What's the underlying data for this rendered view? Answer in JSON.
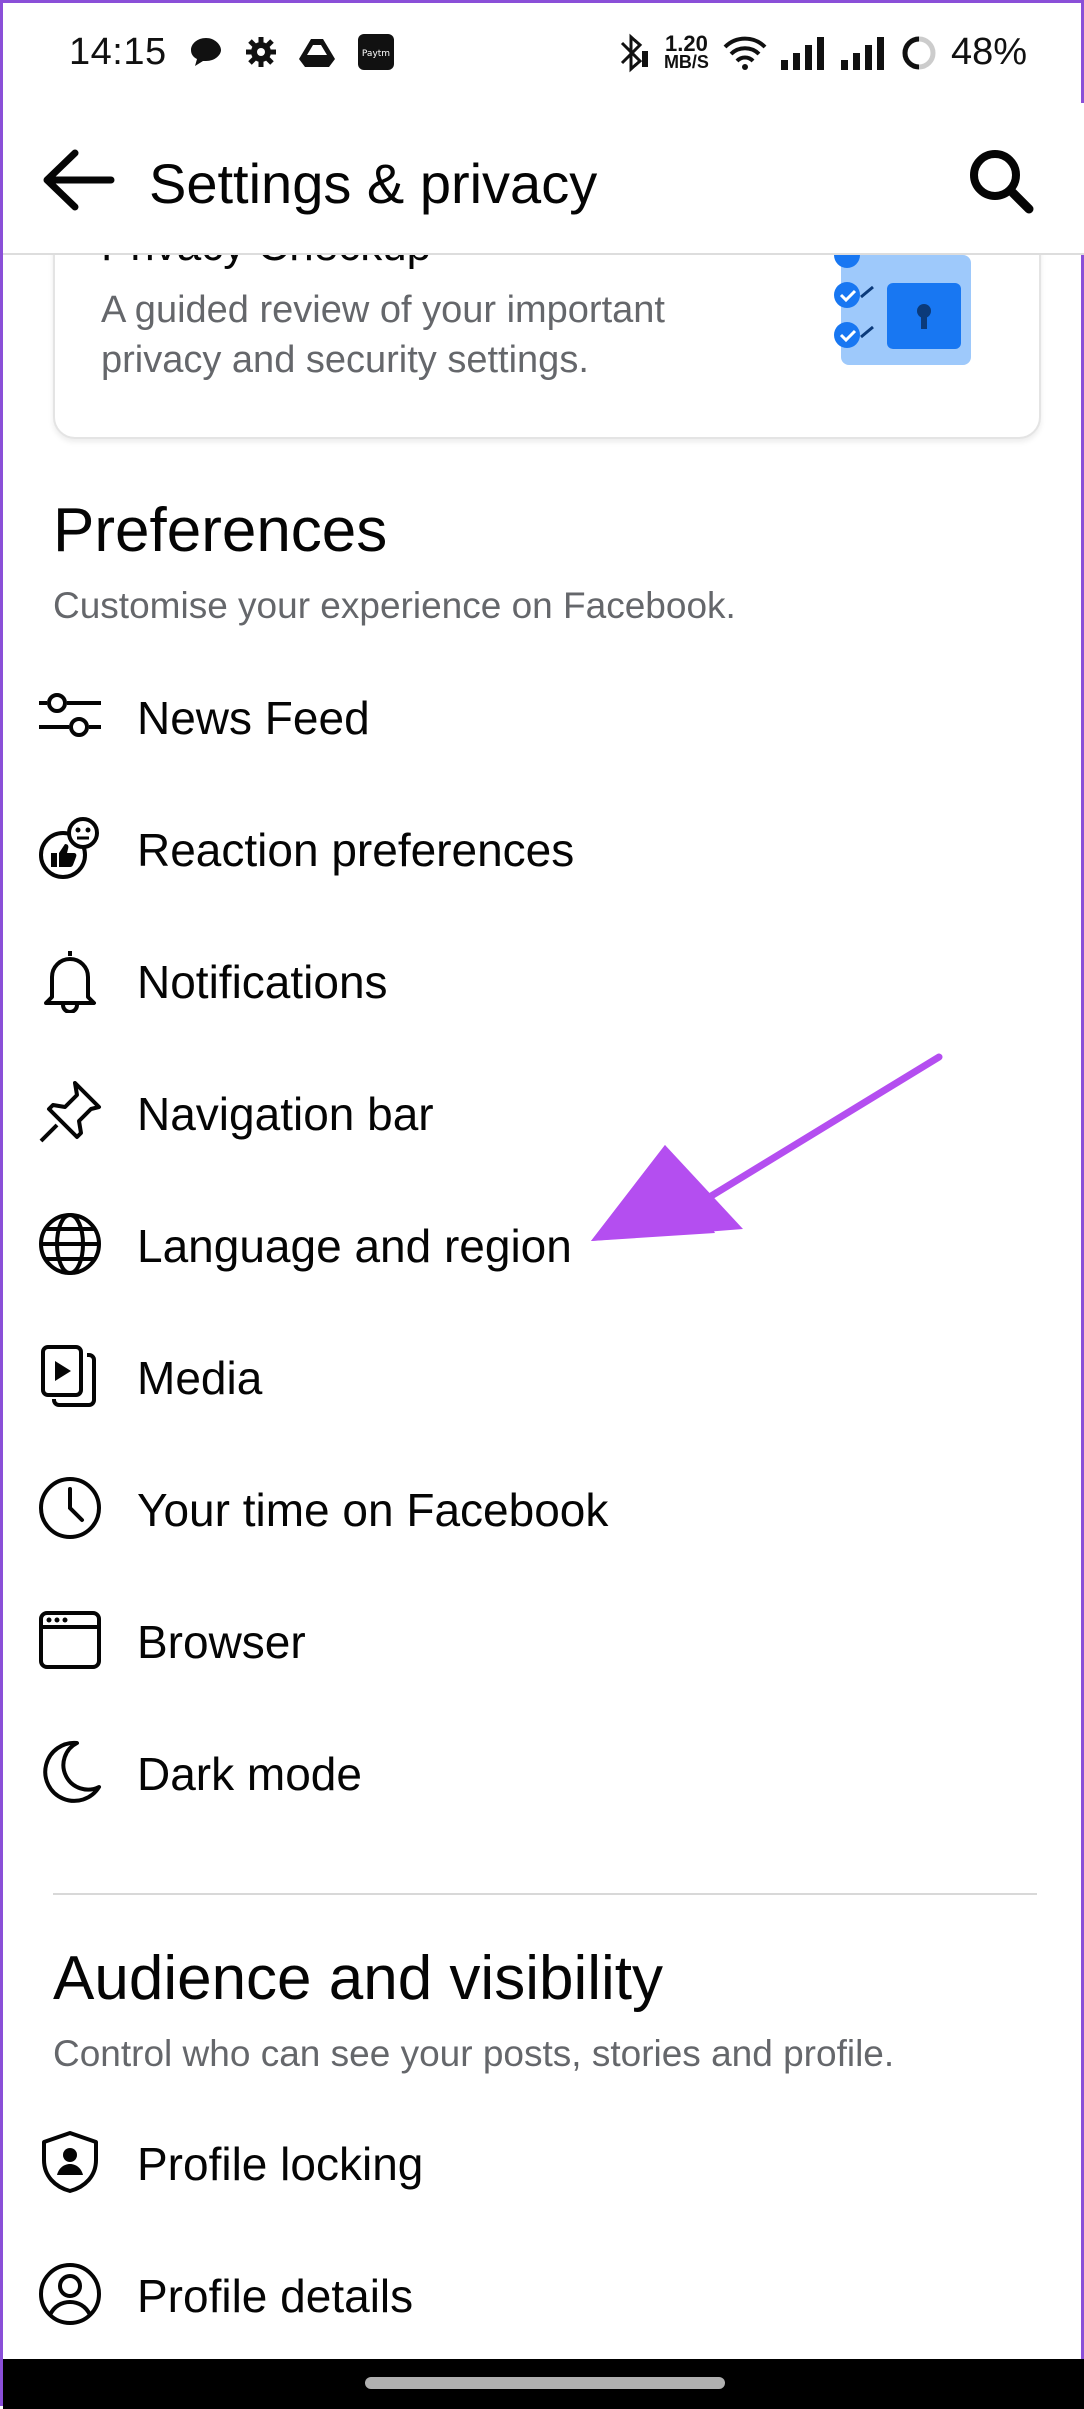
{
  "status_bar": {
    "time": "14:15",
    "net_speed_value": "1.20",
    "net_speed_unit": "MB/S",
    "battery_percent": "48%"
  },
  "header": {
    "title": "Settings & privacy",
    "back_icon": "arrow-left-icon",
    "search_icon": "search-icon"
  },
  "privacy_card": {
    "title": "Privacy Checkup",
    "description": "A guided review of your important privacy and security settings."
  },
  "preferences": {
    "title": "Preferences",
    "subtitle": "Customise your experience on Facebook.",
    "items": [
      {
        "label": "News Feed",
        "icon": "sliders-icon"
      },
      {
        "label": "Reaction preferences",
        "icon": "reactions-icon"
      },
      {
        "label": "Notifications",
        "icon": "bell-icon"
      },
      {
        "label": "Navigation bar",
        "icon": "pin-icon"
      },
      {
        "label": "Language and region",
        "icon": "globe-icon"
      },
      {
        "label": "Media",
        "icon": "media-icon"
      },
      {
        "label": "Your time on Facebook",
        "icon": "clock-icon"
      },
      {
        "label": "Browser",
        "icon": "browser-icon"
      },
      {
        "label": "Dark mode",
        "icon": "moon-icon"
      }
    ]
  },
  "audience": {
    "title": "Audience and visibility",
    "subtitle": "Control who can see your posts, stories and profile.",
    "items": [
      {
        "label": "Profile locking",
        "icon": "shield-person-icon"
      },
      {
        "label": "Profile details",
        "icon": "person-circle-icon"
      }
    ]
  },
  "colors": {
    "annotation_arrow": "#b44ef0",
    "illustration_blue": "#1877f2",
    "illustration_light": "#9ec9fb"
  }
}
